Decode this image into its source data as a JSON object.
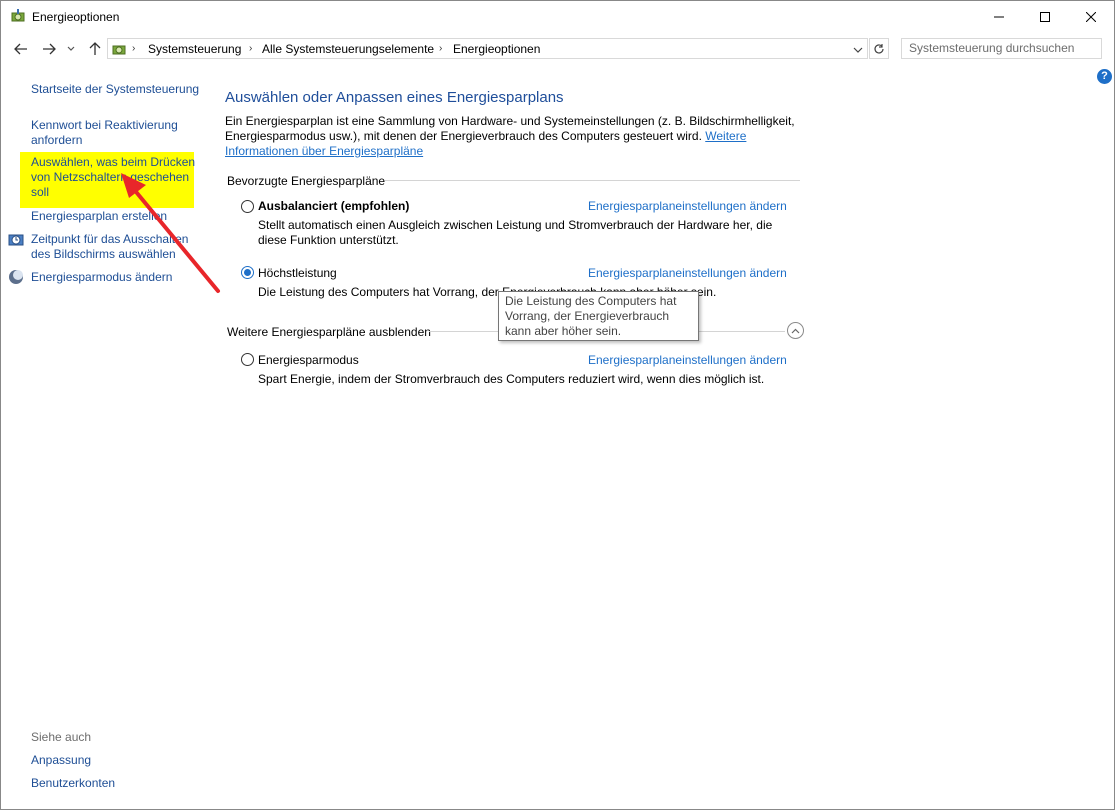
{
  "window": {
    "title": "Energieoptionen",
    "icon": "power-options-icon"
  },
  "navbar": {
    "breadcrumbs": [
      "Systemsteuerung",
      "Alle Systemsteuerungselemente",
      "Energieoptionen"
    ],
    "search_placeholder": "Systemsteuerung durchsuchen"
  },
  "sidebar": {
    "links": [
      {
        "label": "Startseite der Systemsteuerung"
      },
      {
        "label": "Kennwort bei Reaktivierung anfordern"
      },
      {
        "label": "Auswählen, was beim Drücken von Netzschaltern geschehen soll",
        "highlighted": true
      },
      {
        "label": "Energiesparplan erstellen"
      },
      {
        "label": "Zeitpunkt für das Ausschalten des Bildschirms auswählen",
        "icon": "clock-icon"
      },
      {
        "label": "Energiesparmodus ändern",
        "icon": "moon-icon"
      }
    ],
    "see_also_heading": "Siehe auch",
    "see_also": [
      {
        "label": "Anpassung"
      },
      {
        "label": "Benutzerkonten"
      }
    ]
  },
  "main": {
    "title": "Auswählen oder Anpassen eines Energiesparplans",
    "description": "Ein Energiesparplan ist eine Sammlung von Hardware- und Systemeinstellungen (z. B. Bildschirmhelligkeit, Energiesparmodus usw.), mit denen der Energieverbrauch des Computers gesteuert wird.",
    "description_link": "Weitere Informationen über Energiesparpläne",
    "preferred_heading": "Bevorzugte Energiesparpläne",
    "hidden_heading": "Weitere Energiesparpläne ausblenden",
    "change_link": "Energiesparplaneinstellungen ändern",
    "plans": [
      {
        "name": "Ausbalanciert (empfohlen)",
        "selected": false,
        "description": "Stellt automatisch einen Ausgleich zwischen Leistung und Stromverbrauch der Hardware her, die diese Funktion unterstützt."
      },
      {
        "name": "Höchstleistung",
        "selected": true,
        "description": "Die Leistung des Computers hat Vorrang, der Energieverbrauch kann aber höher sein."
      },
      {
        "name": "Energiesparmodus",
        "selected": false,
        "description": "Spart Energie, indem der Stromverbrauch des Computers reduziert wird, wenn dies möglich ist."
      }
    ],
    "tooltip": "Die Leistung des Computers hat Vorrang, der Energieverbrauch kann aber höher sein."
  },
  "colors": {
    "link": "#1e6fc8",
    "highlight": "#ffff00",
    "arrow": "#e8262a"
  }
}
